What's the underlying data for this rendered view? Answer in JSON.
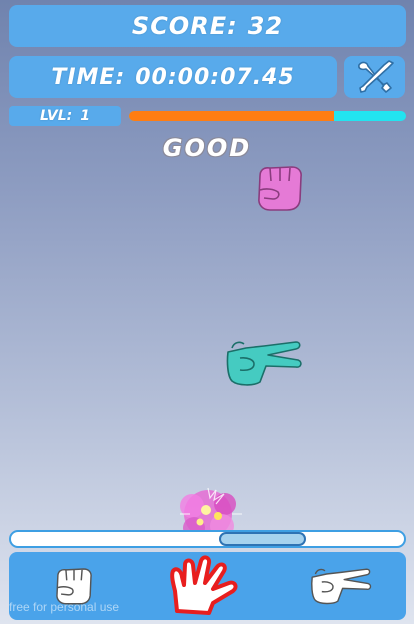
{
  "hud": {
    "score_label": "SCORE:",
    "score_value": "32",
    "time_label": "TIME:",
    "time_value": "00:00:07.45",
    "level_label": "LVL:",
    "level_value": "1",
    "settings_icon": "wrench-screwdriver-icon"
  },
  "level_progress": {
    "fraction": 0.74,
    "fill_color": "#ff7d12",
    "track_color": "#22e4f0"
  },
  "rating": "GOOD",
  "falling_hands": [
    {
      "type": "rock",
      "color": "#e57ad6",
      "icon": "fist-icon"
    },
    {
      "type": "scissors",
      "color": "#45cbc1",
      "icon": "peace-hand-icon"
    },
    {
      "type": "paper",
      "color": "#e57ad6",
      "icon": "open-hand-icon",
      "state": "exploding"
    }
  ],
  "timing_bar": {
    "zone_start": 0.53,
    "zone_end": 0.75
  },
  "controls": [
    {
      "type": "rock",
      "icon": "fist-icon",
      "selected": false
    },
    {
      "type": "paper",
      "icon": "open-hand-icon",
      "selected": true,
      "highlight_color": "#e81e1e"
    },
    {
      "type": "scissors",
      "icon": "peace-hand-icon",
      "selected": false
    }
  ],
  "watermark": "free for personal use"
}
